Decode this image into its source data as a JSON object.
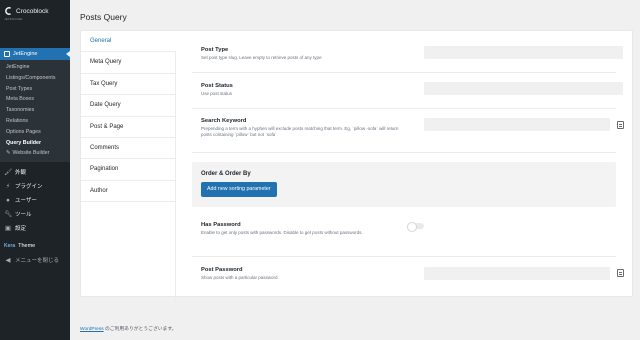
{
  "sidebar": {
    "brand": "Crocoblock",
    "brand_sub": "JETENGINE",
    "active": "JetEngine",
    "submenu": [
      "JetEngine",
      "Listings/Components",
      "Post Types",
      "Meta Boxes",
      "Taxonomies",
      "Relations",
      "Options Pages",
      "Query Builder",
      "Website Builder"
    ],
    "current": "Query Builder",
    "menu": [
      {
        "label": "外観",
        "icon": "paintbrush-icon"
      },
      {
        "label": "プラグイン",
        "icon": "plugin-icon"
      },
      {
        "label": "ユーザー",
        "icon": "user-icon"
      },
      {
        "label": "ツール",
        "icon": "wrench-icon"
      },
      {
        "label": "設定",
        "icon": "settings-icon"
      }
    ],
    "theme_badge": "Kera",
    "theme_label": "Theme",
    "collapse": "メニューを閉じる"
  },
  "page_title": "Posts Query",
  "tabs": [
    "General",
    "Meta Query",
    "Tax Query",
    "Date Query",
    "Post & Page",
    "Comments",
    "Pagination",
    "Author"
  ],
  "fields": {
    "post_type": {
      "label": "Post Type",
      "desc": "Set post type slug. Leave empty to retrieve posts of any type"
    },
    "post_status": {
      "label": "Post Status",
      "desc": "Use post status"
    },
    "search_keyword": {
      "label": "Search Keyword",
      "desc": "Prepending a term with a hyphen will exclude posts matching that term. Eg, `pillow -sofa` will return posts containing `pillow` but not `sofa`"
    },
    "order": {
      "label": "Order & Order By",
      "button": "Add new sorting parameter"
    },
    "has_password": {
      "label": "Has Password",
      "desc": "Enable to get only posts with passwords. Disable to get posts without passwords."
    },
    "post_password": {
      "label": "Post Password",
      "desc": "Show posts with a particular password"
    }
  },
  "footer": {
    "link": "WordPress",
    "text": " のご利用ありがとうございます。"
  }
}
